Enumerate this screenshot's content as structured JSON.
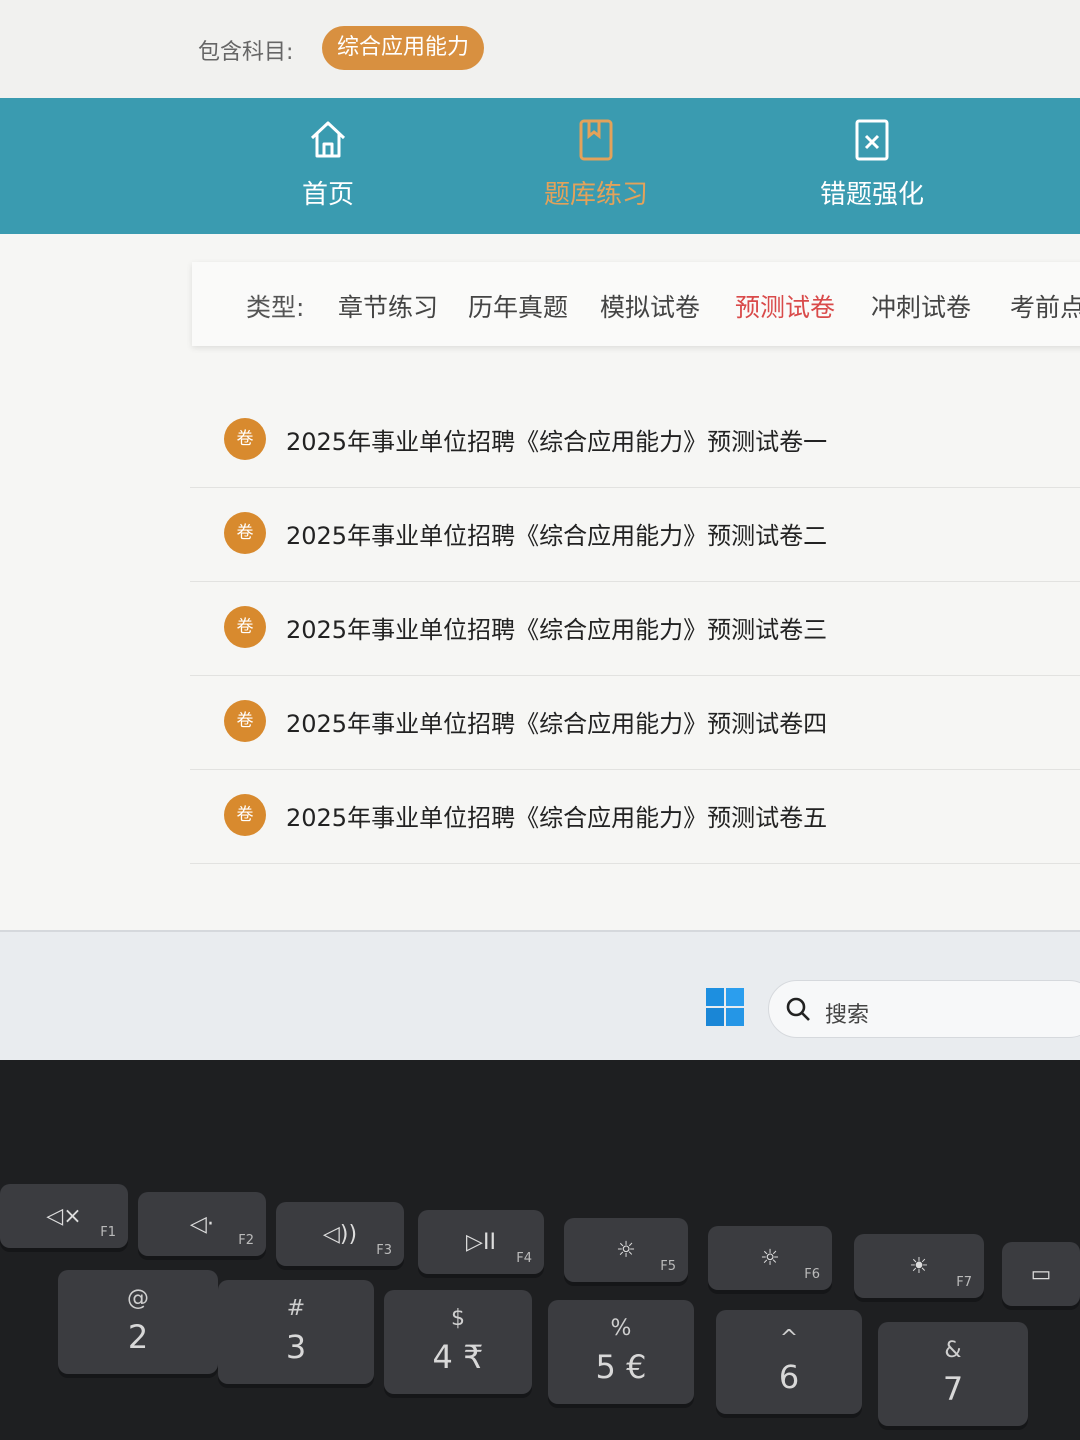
{
  "subject": {
    "label": "包含科目:",
    "selected": "综合应用能力"
  },
  "nav": {
    "items": [
      {
        "label": "首页",
        "icon": "home-icon",
        "active": false
      },
      {
        "label": "题库练习",
        "icon": "notebook-icon",
        "active": true
      },
      {
        "label": "错题强化",
        "icon": "wrong-book-icon",
        "active": false
      }
    ]
  },
  "type_filter": {
    "label": "类型:",
    "tabs": [
      {
        "label": "章节练习",
        "active": false
      },
      {
        "label": "历年真题",
        "active": false
      },
      {
        "label": "模拟试卷",
        "active": false
      },
      {
        "label": "预测试卷",
        "active": true
      },
      {
        "label": "冲刺试卷",
        "active": false
      },
      {
        "label": "考前点",
        "active": false
      }
    ]
  },
  "papers": [
    {
      "badge": "卷",
      "title": "2025年事业单位招聘《综合应用能力》预测试卷一"
    },
    {
      "badge": "卷",
      "title": "2025年事业单位招聘《综合应用能力》预测试卷二"
    },
    {
      "badge": "卷",
      "title": "2025年事业单位招聘《综合应用能力》预测试卷三"
    },
    {
      "badge": "卷",
      "title": "2025年事业单位招聘《综合应用能力》预测试卷四"
    },
    {
      "badge": "卷",
      "title": "2025年事业单位招聘《综合应用能力》预测试卷五"
    }
  ],
  "taskbar": {
    "start_icon": "windows-start-icon",
    "search_placeholder": "搜索"
  },
  "keyboard": {
    "fn_row": [
      {
        "glyph": "◁×",
        "fn": "F1",
        "icon": "mute-icon"
      },
      {
        "glyph": "◁·",
        "fn": "F2",
        "icon": "volume-down-icon"
      },
      {
        "glyph": "◁))",
        "fn": "F3",
        "icon": "volume-up-icon"
      },
      {
        "glyph": "▷II",
        "fn": "F4",
        "icon": "play-pause-icon"
      },
      {
        "glyph": "☼",
        "fn": "F5",
        "icon": "keyboard-backlight-icon"
      },
      {
        "glyph": "☼",
        "fn": "F6",
        "icon": "brightness-down-icon"
      },
      {
        "glyph": "☀",
        "fn": "F7",
        "icon": "brightness-up-icon"
      },
      {
        "glyph": "▭",
        "fn": "",
        "icon": "display-icon"
      }
    ],
    "num_row": [
      {
        "top": "@",
        "main": "2"
      },
      {
        "top": "#",
        "main": "3"
      },
      {
        "top": "$",
        "main": "4 ₹"
      },
      {
        "top": "%",
        "main": "5 €"
      },
      {
        "top": "^",
        "main": "6"
      },
      {
        "top": "&",
        "main": "7"
      }
    ]
  },
  "colors": {
    "nav_bg": "#3a9bb0",
    "accent_orange": "#d88a2e",
    "active_tab_red": "#d94a4a"
  }
}
